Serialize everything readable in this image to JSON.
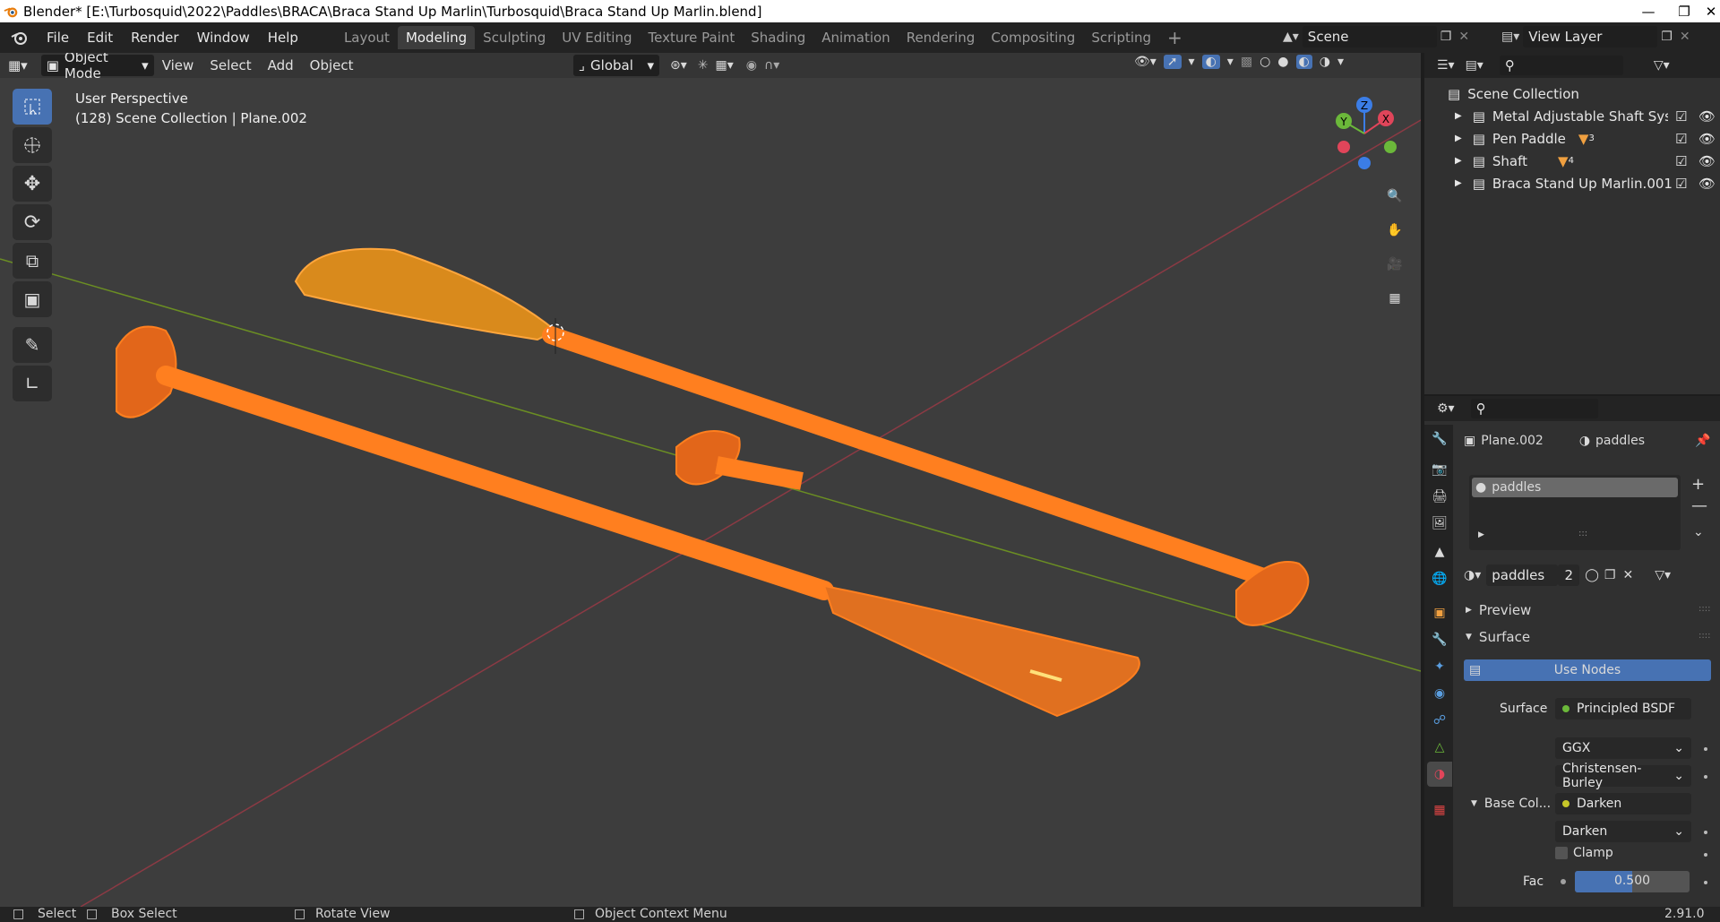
{
  "titlebar": {
    "title": "Blender* [E:\\Turbosquid\\2022\\Paddles\\BRACA\\Braca Stand Up Marlin\\Turbosquid\\Braca Stand Up Marlin.blend]"
  },
  "menus": [
    "File",
    "Edit",
    "Render",
    "Window",
    "Help"
  ],
  "workspace_tabs": [
    {
      "label": "Layout",
      "active": false
    },
    {
      "label": "Modeling",
      "active": true
    },
    {
      "label": "Sculpting",
      "active": false
    },
    {
      "label": "UV Editing",
      "active": false
    },
    {
      "label": "Texture Paint",
      "active": false
    },
    {
      "label": "Shading",
      "active": false
    },
    {
      "label": "Animation",
      "active": false
    },
    {
      "label": "Rendering",
      "active": false
    },
    {
      "label": "Compositing",
      "active": false
    },
    {
      "label": "Scripting",
      "active": false
    }
  ],
  "scene": {
    "name": "Scene"
  },
  "view_layer": {
    "name": "View Layer"
  },
  "viewport_header": {
    "mode": "Object Mode",
    "menus": [
      "View",
      "Select",
      "Add",
      "Object"
    ],
    "orientation": "Global"
  },
  "viewport": {
    "perspective": "User Perspective",
    "collection_info": "(128) Scene Collection | Plane.002"
  },
  "gizmo": {
    "x": "X",
    "y": "Y",
    "z": "Z"
  },
  "outliner": {
    "root": "Scene Collection",
    "items": [
      {
        "label": "Metal Adjustable Shaft System",
        "badge": ""
      },
      {
        "label": "Pen Paddle",
        "badge": "3"
      },
      {
        "label": "Shaft",
        "badge": "4"
      },
      {
        "label": "Braca Stand Up Marlin.001",
        "badge": ""
      }
    ]
  },
  "properties": {
    "object_name": "Plane.002",
    "material_name": "paddles",
    "slot_name": "paddles",
    "datablock_name": "paddles",
    "user_count": "2",
    "panel_preview": "Preview",
    "panel_surface": "Surface",
    "use_nodes_label": "Use Nodes",
    "surface_label": "Surface",
    "surface_value": "Principled BSDF",
    "distribution": "GGX",
    "subsurface_method": "Christensen-Burley",
    "base_color_label": "Base Col...",
    "base_color_value": "Darken",
    "blend_mode": "Darken",
    "clamp_label": "Clamp",
    "fac_label": "Fac",
    "fac_value": "0.500"
  },
  "statusbar": {
    "select": "Select",
    "box_select": "Box Select",
    "rotate_view": "Rotate View",
    "context_menu": "Object Context Menu",
    "version": "2.91.0"
  },
  "colors": {
    "accent": "#4772b3",
    "selection": "#ff7f1f",
    "active_object": "#ffa63d",
    "x_axis": "#8b3a44",
    "y_axis": "#6b8e23"
  }
}
